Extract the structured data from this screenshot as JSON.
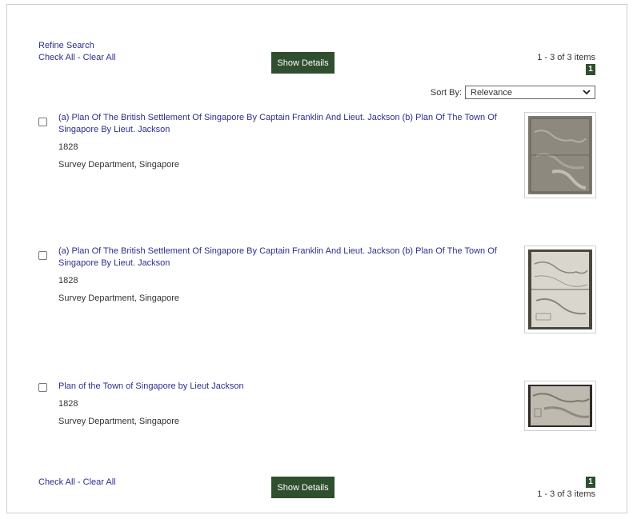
{
  "top": {
    "refine_search": "Refine Search",
    "check_all": "Check All",
    "separator": " - ",
    "clear_all": "Clear All",
    "show_details": "Show Details",
    "range_text": "1 - 3 of 3 items",
    "page": "1"
  },
  "sort": {
    "label": "Sort By:",
    "selected": "Relevance"
  },
  "results": [
    {
      "title": "(a) Plan Of The British Settlement Of Singapore By Captain Franklin And Lieut. Jackson (b) Plan Of The Town Of Singapore By Lieut. Jackson",
      "year": "1828",
      "publisher": "Survey Department, Singapore"
    },
    {
      "title": "(a) Plan Of The British Settlement Of Singapore By Captain Franklin And Lieut. Jackson (b) Plan Of The Town Of Singapore By Lieut. Jackson",
      "year": "1828",
      "publisher": "Survey Department, Singapore"
    },
    {
      "title": "Plan of the Town of Singapore by Lieut Jackson",
      "year": "1828",
      "publisher": "Survey Department, Singapore"
    }
  ],
  "bottom": {
    "check_all": "Check All",
    "separator": " - ",
    "clear_all": "Clear All",
    "show_details": "Show Details",
    "page": "1",
    "range_text": "1 - 3 of 3 items"
  },
  "colors": {
    "accent": "#2f4f2f",
    "link": "#2e2e8f"
  }
}
